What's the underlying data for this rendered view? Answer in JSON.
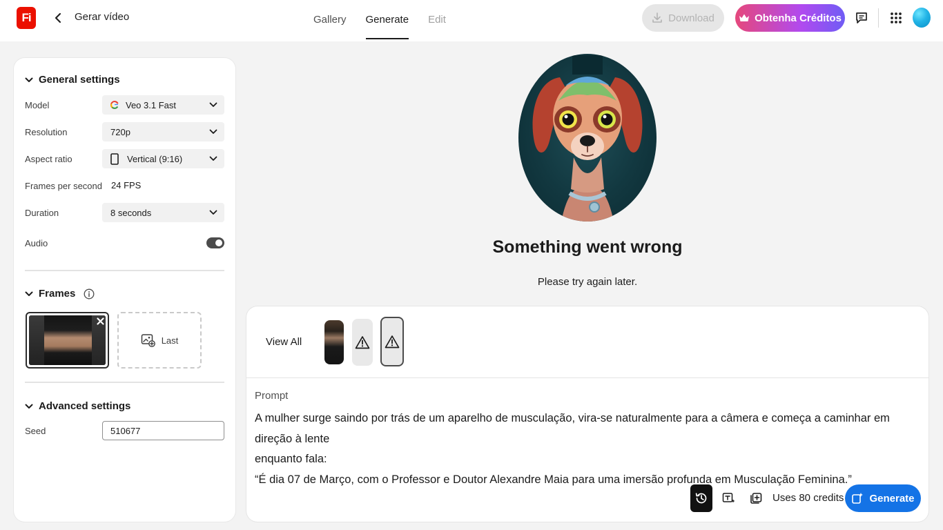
{
  "app": {
    "logo_text": "Fi",
    "page_title": "Gerar vídeo"
  },
  "tabs": [
    {
      "label": "Gallery",
      "state": "normal"
    },
    {
      "label": "Generate",
      "state": "active"
    },
    {
      "label": "Edit",
      "state": "disabled"
    }
  ],
  "toolbar": {
    "download_label": "Download",
    "credits_label": "Obtenha Créditos",
    "icons": [
      "download-icon",
      "crown-icon",
      "feedback-icon",
      "apps-grid-icon",
      "user-avatar"
    ]
  },
  "general_settings": {
    "title": "General settings",
    "model_label": "Model",
    "model_value": "Veo 3.1 Fast",
    "resolution_label": "Resolution",
    "resolution_value": "720p",
    "aspect_label": "Aspect ratio",
    "aspect_value": "Vertical (9:16)",
    "fps_label": "Frames per second",
    "fps_value": "24 FPS",
    "duration_label": "Duration",
    "duration_value": "8 seconds",
    "audio_label": "Audio",
    "audio_on": true
  },
  "frames": {
    "title": "Frames",
    "last_label": "Last"
  },
  "advanced_settings": {
    "title": "Advanced settings",
    "seed_label": "Seed",
    "seed_value": "510677"
  },
  "result": {
    "error_title": "Something went wrong",
    "error_subtitle": "Please try again later."
  },
  "history": {
    "view_all": "View All"
  },
  "prompt": {
    "label": "Prompt",
    "text": "A mulher surge saindo por trás de um aparelho de musculação, vira-se naturalmente para a câmera e começa a caminhar em direção à lente\nenquanto fala:\n“É dia 07 de Março, com o Professor e Doutor Alexandre Maia para uma imersão profunda em Musculação Feminina.”"
  },
  "actions": {
    "uses_credits": "Uses 80 credits",
    "generate_label": "Generate"
  },
  "colors": {
    "accent_blue": "#1473e6",
    "brand_red": "#eb1000",
    "credits_gradient_start": "#e5487c",
    "credits_gradient_end": "#6f5cf5"
  }
}
